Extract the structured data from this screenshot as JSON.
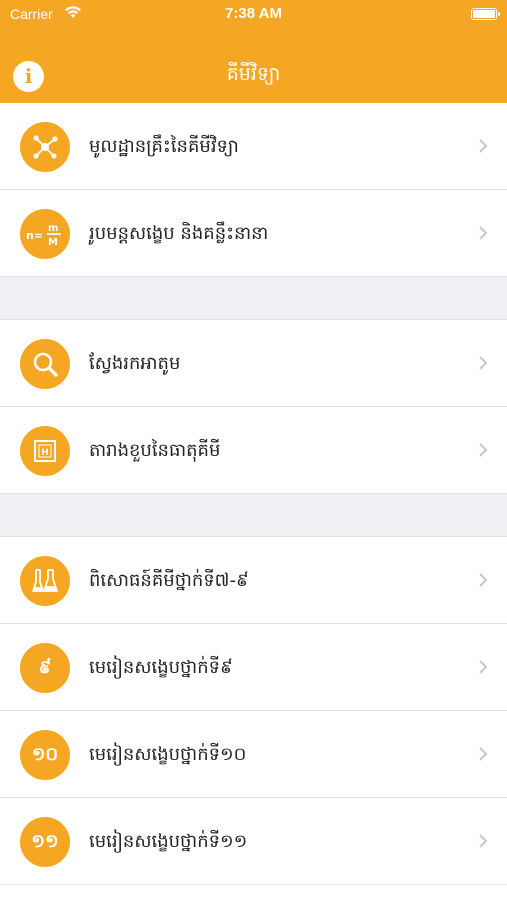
{
  "status_bar": {
    "carrier": "Carrier",
    "time": "7:38 AM"
  },
  "nav": {
    "info_label": "i",
    "title": "គីមីវិទ្យា"
  },
  "colors": {
    "accent": "#f5a623",
    "separator_bg": "#efeff4"
  },
  "sections": [
    {
      "items": [
        {
          "label": "មូលដ្ឋានគ្រឹះនៃគីមីវិទ្យា",
          "icon": "molecule-icon"
        },
        {
          "label": "រូបមន្តសង្ខេប និងគន្លឹះនានា",
          "icon": "formula-icon",
          "icon_text": "n="
        }
      ]
    },
    {
      "items": [
        {
          "label": "ស្វែងរកអាតូម",
          "icon": "search-icon"
        },
        {
          "label": "តារាងខួបនៃធាតុគីមី",
          "icon": "periodic-table-icon",
          "icon_text": "H"
        }
      ]
    },
    {
      "items": [
        {
          "label": "ពិសោធន៍គីមីថ្នាក់ទី៧-៩",
          "icon": "flask-icon"
        },
        {
          "label": "មេរៀនសង្ខេបថ្នាក់ទី៩",
          "icon": "grade-9-icon",
          "icon_text": "៩"
        },
        {
          "label": "មេរៀនសង្ខេបថ្នាក់ទី១០",
          "icon": "grade-10-icon",
          "icon_text": "១០"
        },
        {
          "label": "មេរៀនសង្ខេបថ្នាក់ទី១១",
          "icon": "grade-11-icon",
          "icon_text": "១១"
        }
      ]
    }
  ]
}
